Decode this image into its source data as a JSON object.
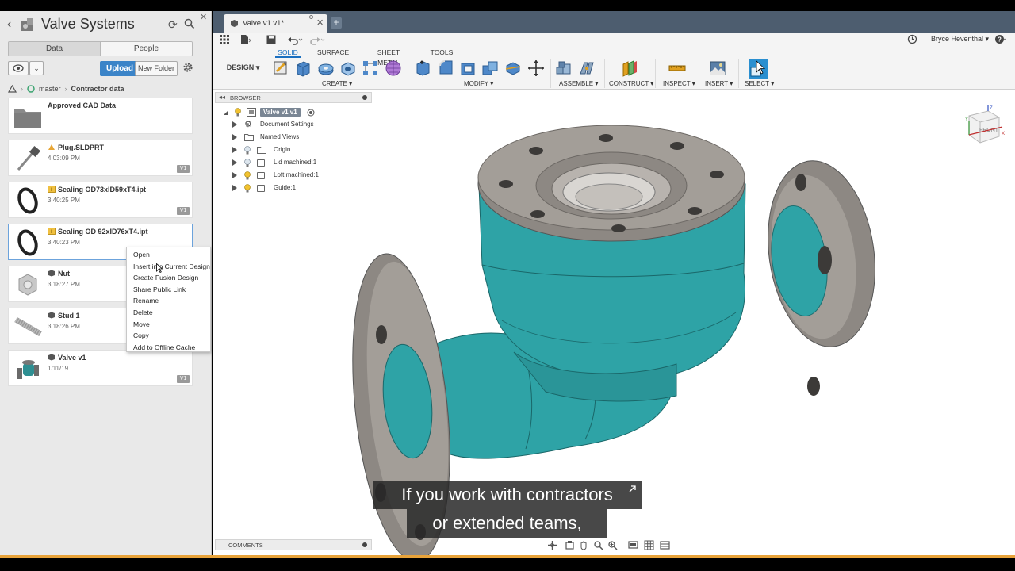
{
  "data_panel": {
    "project_title": "Valve Systems",
    "tabs": [
      {
        "label": "Data",
        "active": true
      },
      {
        "label": "People",
        "active": false
      }
    ],
    "upload_label": "Upload",
    "new_folder_label": "New Folder",
    "breadcrumb": {
      "branch": "master",
      "folder": "Contractor data"
    },
    "files": [
      {
        "name": "Approved CAD Data",
        "time": "",
        "version": "",
        "kind": "folder"
      },
      {
        "name": "Plug.SLDPRT",
        "time": "4:03:09 PM",
        "version": "V1",
        "kind": "solidworks"
      },
      {
        "name": "Sealing OD73xID59xT4.ipt",
        "time": "3:40:25 PM",
        "version": "V1",
        "kind": "inventor"
      },
      {
        "name": "Sealing OD 92xID76xT4.ipt",
        "time": "3:40:23 PM",
        "version": "",
        "kind": "inventor"
      },
      {
        "name": "Nut",
        "time": "3:18:27 PM",
        "version": "",
        "kind": "fusion"
      },
      {
        "name": "Stud 1",
        "time": "3:18:26 PM",
        "version": "",
        "kind": "fusion"
      },
      {
        "name": "Valve v1",
        "time": "1/11/19",
        "version": "V1",
        "kind": "fusion"
      }
    ]
  },
  "context_menu": {
    "items": [
      "Open",
      "Insert into Current Design",
      "Create Fusion Design",
      "Share Public Link",
      "Rename",
      "Delete",
      "Move",
      "Copy",
      "Add to Offline Cache"
    ]
  },
  "document_tab": {
    "label": "Valve v1 v1*"
  },
  "user": {
    "name": "Bryce Heventhal ▾"
  },
  "ribbon": {
    "workspace": "DESIGN ▾",
    "tabs": [
      {
        "label": "SOLID",
        "active": true
      },
      {
        "label": "SURFACE",
        "active": false
      },
      {
        "label": "SHEET METAL",
        "active": false
      },
      {
        "label": "TOOLS",
        "active": false
      }
    ],
    "groups": {
      "create": "CREATE ▾",
      "modify": "MODIFY ▾",
      "assemble": "ASSEMBLE ▾",
      "construct": "CONSTRUCT ▾",
      "inspect": "INSPECT ▾",
      "insert": "INSERT ▾",
      "select": "SELECT ▾"
    }
  },
  "browser": {
    "title": "BROWSER",
    "root": "Valve v1 v1",
    "items": [
      "Document Settings",
      "Named Views",
      "Origin",
      "Lid machined:1",
      "Loft machined:1",
      "Guide:1"
    ]
  },
  "viewcube": {
    "face": "FRONT"
  },
  "comments_label": "COMMENTS",
  "subtitles": [
    "If you work with contractors",
    "or extended teams,"
  ],
  "colors": {
    "accent": "#1a6fc0",
    "upload": "#3b84c8",
    "model_teal": "#2ea3a6",
    "flange_gray": "#8a8580"
  }
}
